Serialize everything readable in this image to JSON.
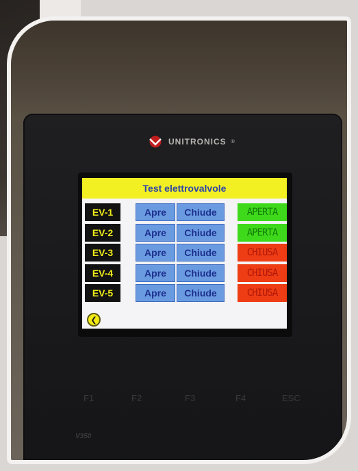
{
  "device": {
    "brand": "UNITRONICS",
    "brand_mark": "®",
    "model": "V350"
  },
  "screen": {
    "title": "Test elettrovalvole",
    "back_icon": "back-arrow-icon",
    "rows": [
      {
        "label": "EV-1",
        "open_label": "Apre",
        "close_label": "Chiude",
        "status": "APERTA",
        "state": "open"
      },
      {
        "label": "EV-2",
        "open_label": "Apre",
        "close_label": "Chiude",
        "status": "APERTA",
        "state": "open"
      },
      {
        "label": "EV-3",
        "open_label": "Apre",
        "close_label": "Chiude",
        "status": "CHIUSA",
        "state": "closed"
      },
      {
        "label": "EV-4",
        "open_label": "Apre",
        "close_label": "Chiude",
        "status": "CHIUSA",
        "state": "closed"
      },
      {
        "label": "EV-5",
        "open_label": "Apre",
        "close_label": "Chiude",
        "status": "CHIUSA",
        "state": "closed"
      }
    ]
  },
  "function_keys": [
    "F1",
    "F2",
    "F3",
    "F4",
    "ESC"
  ],
  "colors": {
    "title_bar": "#f2ef23",
    "open_status": "#3ed91b",
    "closed_status": "#ee3c14",
    "button": "#6a9be0"
  }
}
